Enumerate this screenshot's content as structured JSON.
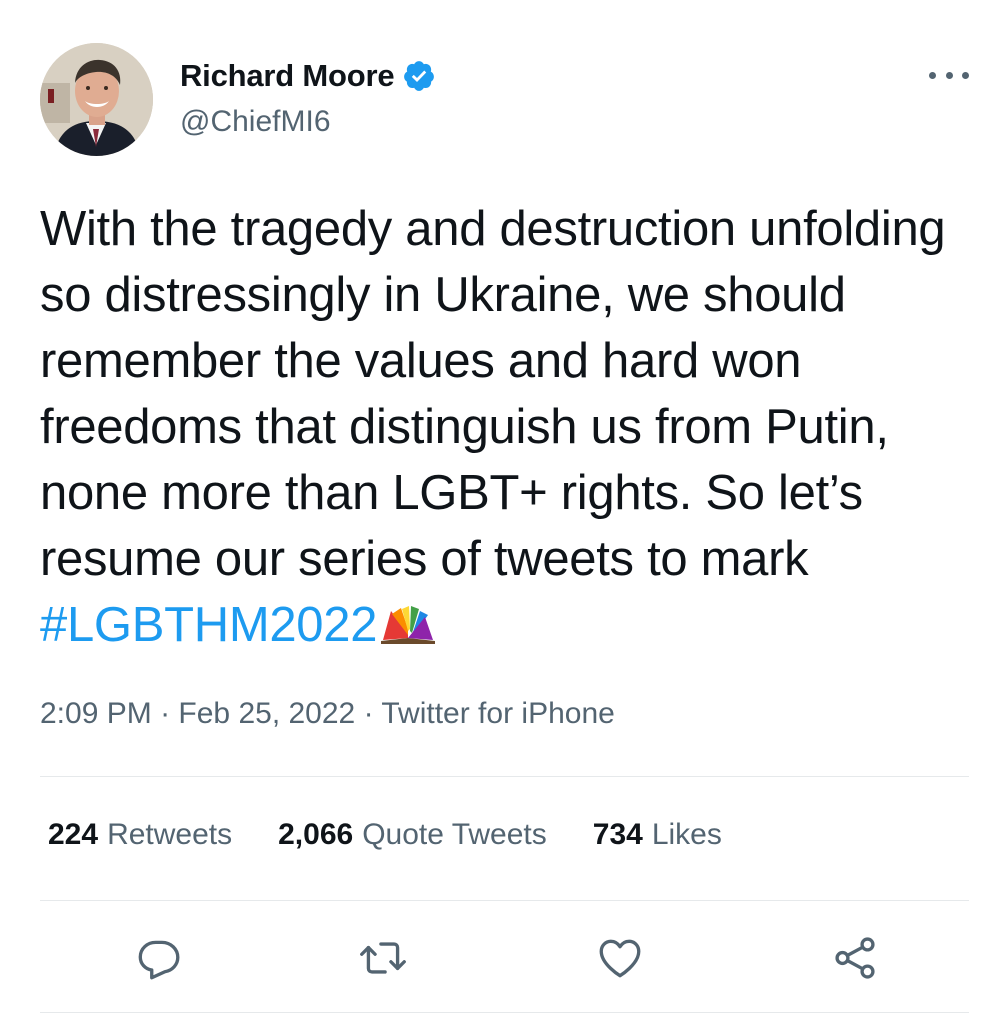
{
  "author": {
    "name": "Richard Moore",
    "handle": "@ChiefMI6",
    "verified": true,
    "avatar_icon": "profile-photo"
  },
  "tweet": {
    "text": "With the tragedy and destruction unfolding so distressingly in Ukraine, we should remember the values and hard won freedoms that distinguish us from Putin, none more than LGBT+ rights. So let’s resume our series of tweets to mark ",
    "hashtag": "#LGBTHM2022",
    "emoji_icon": "rainbow-book-emoji"
  },
  "meta": {
    "time": "2:09 PM",
    "separator": "·",
    "date": "Feb 25, 2022",
    "source": "Twitter for iPhone"
  },
  "stats": {
    "retweets_count": "224",
    "retweets_label": "Retweets",
    "quotes_count": "2,066",
    "quotes_label": "Quote Tweets",
    "likes_count": "734",
    "likes_label": "Likes"
  },
  "actions": [
    {
      "icon": "reply-icon"
    },
    {
      "icon": "retweet-icon"
    },
    {
      "icon": "like-icon"
    },
    {
      "icon": "share-icon"
    }
  ],
  "colors": {
    "accent": "#1d9bf0",
    "text": "#0f1419",
    "secondary": "#536471",
    "divider": "#e6e9eb"
  }
}
